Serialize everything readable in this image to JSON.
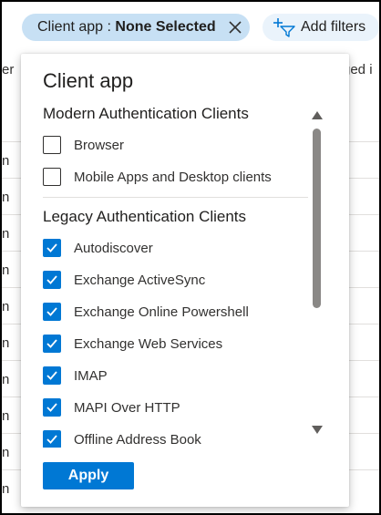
{
  "filter_bar": {
    "client_pill_key": "Client app : ",
    "client_pill_value": "None Selected",
    "add_filters_label": "Add filters"
  },
  "background": {
    "header_left": "er",
    "header_right": "ged i",
    "row_text": [
      "n",
      "n",
      "n",
      "n",
      "n",
      "n",
      "n",
      "n",
      "n",
      "n"
    ]
  },
  "panel": {
    "title": "Client app",
    "modern": {
      "heading": "Modern Authentication Clients",
      "options": [
        {
          "label": "Browser",
          "checked": false
        },
        {
          "label": "Mobile Apps and Desktop clients",
          "checked": false
        }
      ]
    },
    "legacy": {
      "heading": "Legacy Authentication Clients",
      "options": [
        {
          "label": "Autodiscover",
          "checked": true
        },
        {
          "label": "Exchange ActiveSync",
          "checked": true
        },
        {
          "label": "Exchange Online Powershell",
          "checked": true
        },
        {
          "label": "Exchange Web Services",
          "checked": true
        },
        {
          "label": "IMAP",
          "checked": true
        },
        {
          "label": "MAPI Over HTTP",
          "checked": true
        },
        {
          "label": "Offline Address Book",
          "checked": true
        }
      ]
    },
    "apply_label": "Apply"
  },
  "colors": {
    "accent": "#0078d4",
    "pill_bg": "#c7e0f4",
    "pill_add_bg": "#eaf3fb",
    "scroll_thumb": "#8a8886"
  },
  "icons": {
    "pill_close": "close-icon",
    "add_filter": "add-filter-icon",
    "checkbox_check": "checkmark-icon",
    "scroll_up": "scroll-up-arrow-icon",
    "scroll_down": "scroll-down-arrow-icon"
  }
}
